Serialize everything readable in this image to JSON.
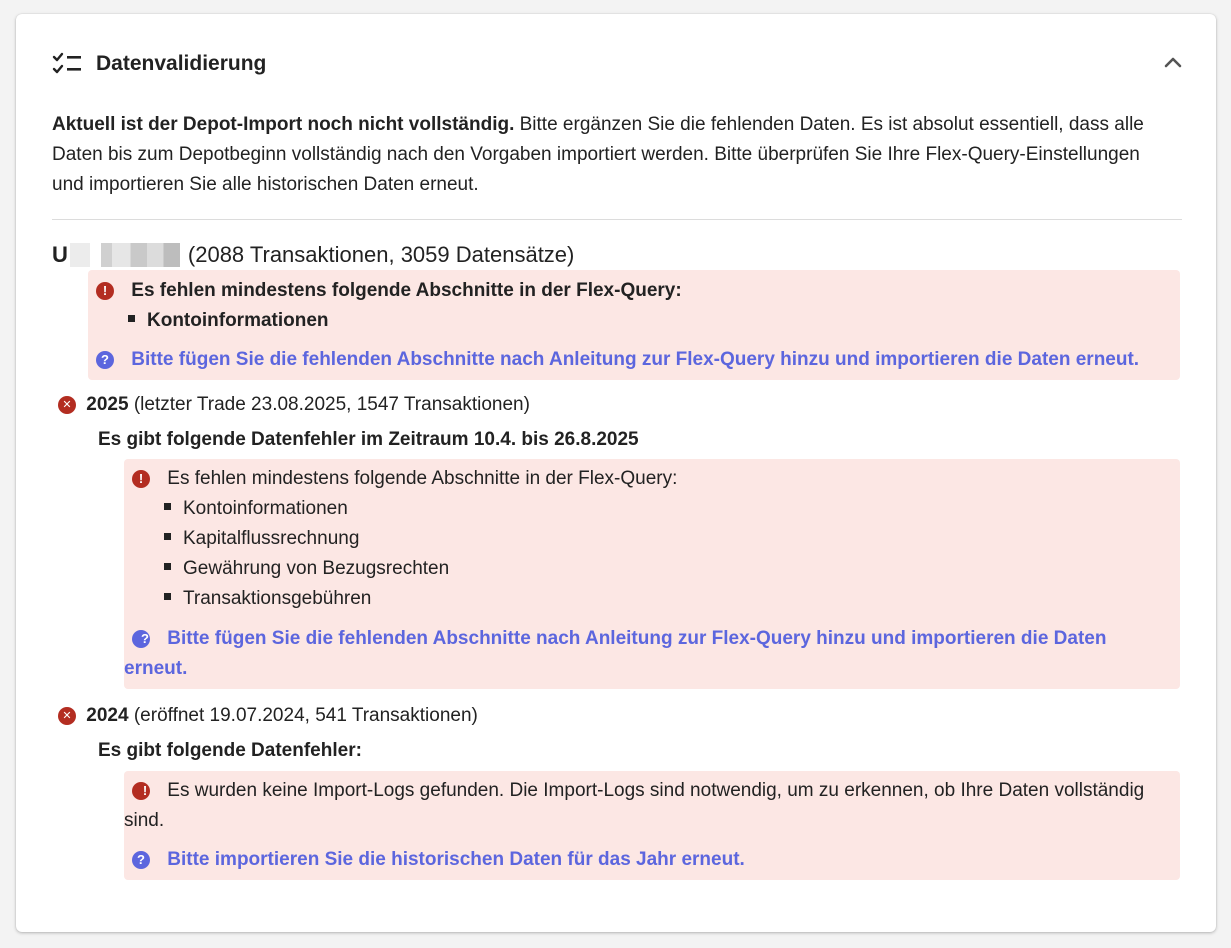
{
  "header": {
    "icon": "checklist-icon",
    "title": "Datenvalidierung",
    "collapse_icon": "chevron-up-icon"
  },
  "intro": {
    "bold": "Aktuell ist der Depot-Import noch nicht vollständig.",
    "rest": " Bitte ergänzen Sie die fehlenden Daten. Es ist absolut essentiell, dass alle Daten bis zum Depotbeginn vollständig nach den Vorgaben importiert werden. Bitte überprüfen Sie Ihre Flex-Query-Einstellungen und importieren Sie alle historischen Daten erneut."
  },
  "account": {
    "id_prefix": "U",
    "summary": "(2088 Transaktionen, 3059 Datensätze)",
    "error": {
      "message": "Es fehlen mindestens folgende Abschnitte in der Flex-Query:",
      "items": [
        "Kontoinformationen"
      ],
      "help": "Bitte fügen Sie die fehlenden Abschnitte nach Anleitung zur Flex-Query hinzu und importieren die Daten erneut."
    }
  },
  "years": [
    {
      "year": "2025",
      "detail": "(letzter Trade 23.08.2025, 1547 Transaktionen)",
      "heading": "Es gibt folgende Datenfehler im Zeitraum 10.4. bis 26.8.2025",
      "error": {
        "message": "Es fehlen mindestens folgende Abschnitte in der Flex-Query:",
        "items": [
          "Kontoinformationen",
          "Kapitalflussrechnung",
          "Gewährung von Bezugsrechten",
          "Transaktionsgebühren"
        ],
        "help": "Bitte fügen Sie die fehlenden Abschnitte nach Anleitung zur Flex-Query hinzu und importieren die Daten erneut."
      }
    },
    {
      "year": "2024",
      "detail": "(eröffnet 19.07.2024, 541 Transaktionen)",
      "heading": "Es gibt folgende Datenfehler:",
      "error": {
        "message": "Es wurden keine Import-Logs gefunden. Die Import-Logs sind notwendig, um zu erkennen, ob Ihre Daten vollständig sind.",
        "help": "Bitte importieren Sie die historischen Daten für das Jahr erneut."
      }
    }
  ],
  "colors": {
    "error_bg": "#fce7e4",
    "error_icon": "#b32d21",
    "link": "#5c66de"
  }
}
